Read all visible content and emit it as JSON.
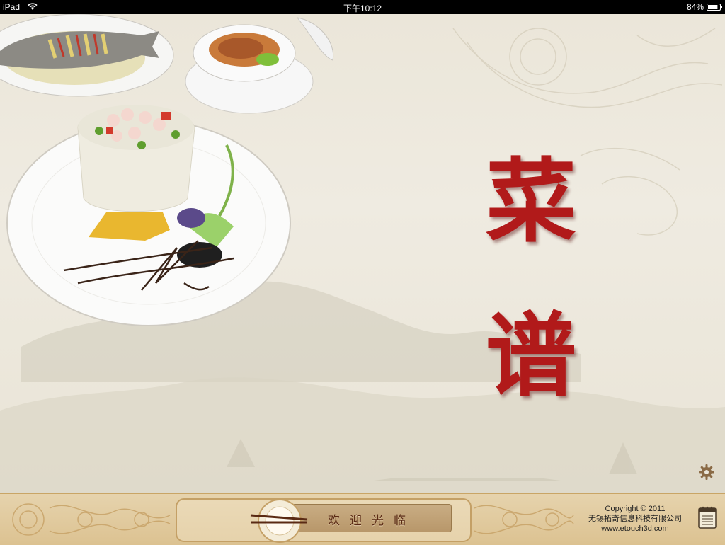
{
  "status_bar": {
    "device": "iPad",
    "time": "下午10:12",
    "battery": "84%",
    "battery_level": 0.84,
    "icons": [
      "wifi-icon",
      "battery-icon"
    ]
  },
  "main": {
    "title_line1": "菜",
    "title_line2": "谱",
    "settings_icon": "gear-icon",
    "accent_color": "#b11a1a"
  },
  "bottom_bar": {
    "welcome_text": "欢迎光临",
    "plate_icon": "plate-chopsticks-icon",
    "copyright_line1": "Copyright © 2011",
    "copyright_line2": "无锡拓奇信息科技有限公司",
    "copyright_line3": "www.etouch3d.com",
    "notepad_icon": "notepad-icon"
  }
}
